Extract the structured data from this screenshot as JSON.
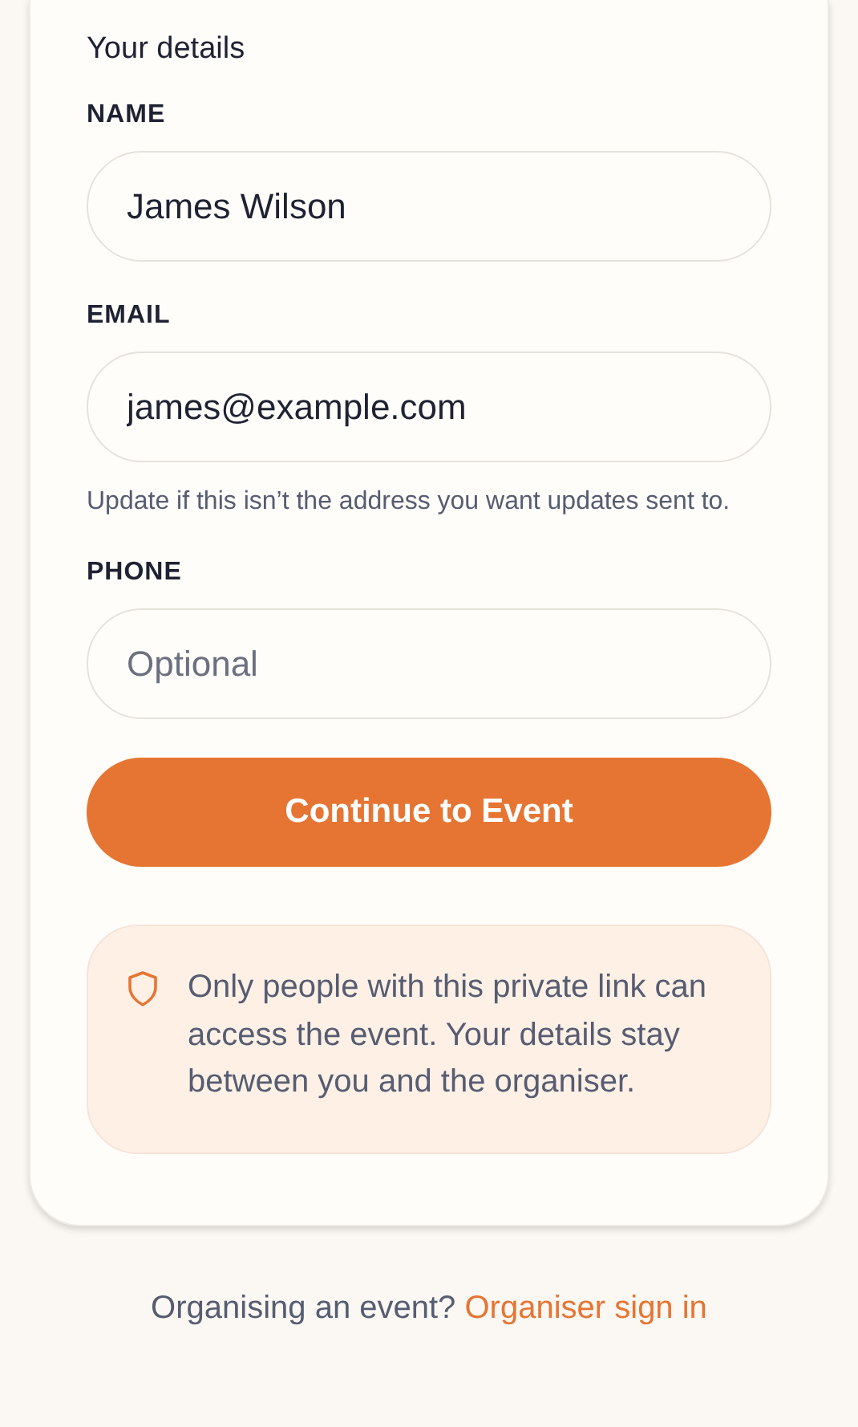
{
  "section_title": "Your details",
  "fields": [
    {
      "label": "NAME",
      "value": "James Wilson"
    },
    {
      "label": "EMAIL",
      "value": "james@example.com",
      "hint": "Update if this isn’t the address you want updates sent to."
    },
    {
      "label": "PHONE",
      "placeholder": "Optional"
    }
  ],
  "submit_button": "Continue to Event",
  "privacy_note": "Only people with this private link can access the event. Your details stay between you and the organiser.",
  "footer": {
    "text": "Organising an event?",
    "link": "Organiser sign in"
  }
}
